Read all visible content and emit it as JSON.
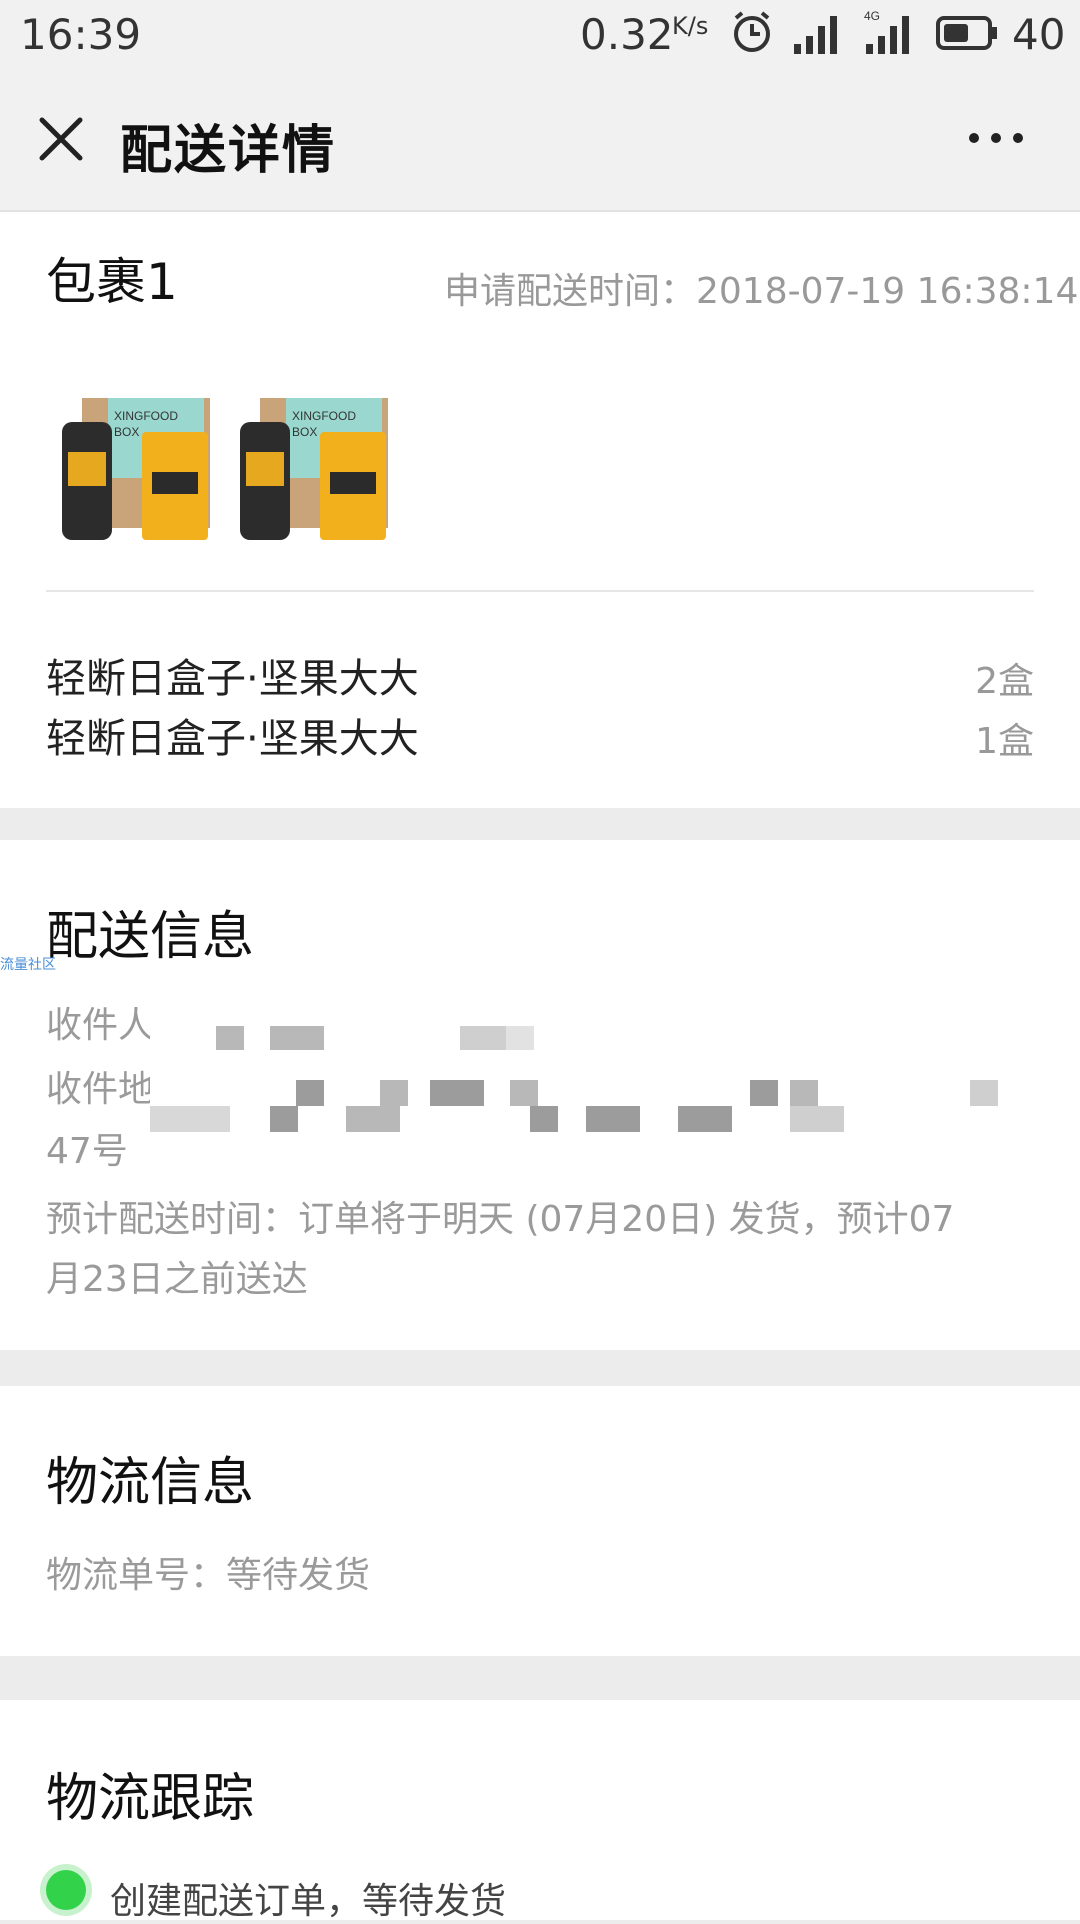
{
  "status_bar": {
    "time": "16:39",
    "net_speed": "0.32",
    "net_speed_unit": "K/s",
    "battery": "40",
    "icons": [
      "alarm-icon",
      "signal-icon",
      "4g-signal-icon",
      "battery-icon"
    ]
  },
  "nav": {
    "title": "配送详情",
    "close_icon": "close-icon",
    "more_icon": "more-icon"
  },
  "package": {
    "title": "包裹1",
    "apply_time_label": "申请配送时间：2018-07-19 16:38:14",
    "items": [
      {
        "name": "轻断日盒子·坚果大大",
        "qty": "2盒"
      },
      {
        "name": "轻断日盒子·坚果大大",
        "qty": "1盒"
      }
    ]
  },
  "delivery": {
    "title": "配送信息",
    "recipient_label": "收件人",
    "address_label": "收件地址",
    "address_tail": "47号",
    "estimate": "预计配送时间：订单将于明天 (07月20日) 发货，预计07",
    "estimate_line2": "月23日之前送达",
    "watermark": "流量社区"
  },
  "logistics": {
    "title": "物流信息",
    "tracking_number": "物流单号：等待发货"
  },
  "tracking": {
    "title": "物流跟踪",
    "events": [
      "创建配送订单，等待发货"
    ]
  },
  "colors": {
    "background": "#ececec",
    "card": "#ffffff",
    "status_dot": "#32d24a",
    "muted_text": "#999999"
  }
}
